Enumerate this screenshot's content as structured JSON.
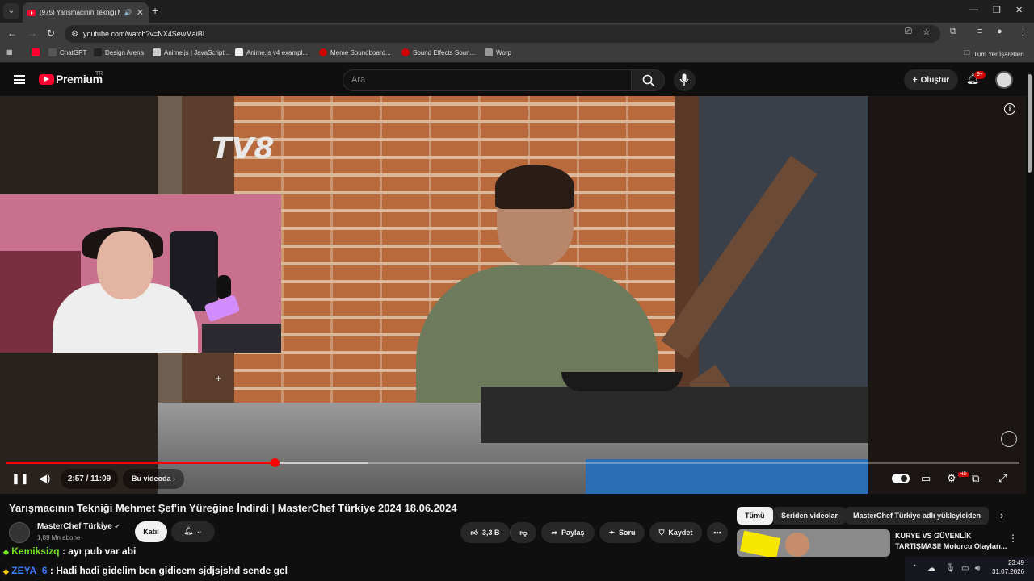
{
  "browser": {
    "tab_title": "(975) Yarışmacının Tekniği M",
    "url": "youtube.com/watch?v=NX4SewMaiBI",
    "bookmarks": [
      "ChatGPT",
      "Design Arena",
      "Anime.js | JavaScript...",
      "Anime.js v4 exampl...",
      "Meme Soundboard...",
      "Sound Effects Soun...",
      "Worp"
    ],
    "bookmarks_all": "Tüm Yer İşaretleri"
  },
  "header": {
    "logo_text": "Premium",
    "region": "TR",
    "search_placeholder": "Ara",
    "create_label": "Oluştur",
    "notif_count": "9+"
  },
  "player": {
    "watermark": "TV8",
    "time": "2:57 / 11:09",
    "chapter_label": "Bu videoda",
    "progress_fraction": 0.265,
    "buffered_fraction": 0.357,
    "hd_badge": "HD"
  },
  "video": {
    "title": "Yarışmacının Tekniği Mehmet Şef'in Yüreğine İndirdi | MasterChef Türkiye 2024 18.06.2024",
    "channel": "MasterChef Türkiye",
    "subscribers": "1,89 Mn abone",
    "join_label": "Katıl",
    "likes": "3,3 B",
    "share_label": "Paylaş",
    "ask_label": "Soru",
    "save_label": "Kaydet"
  },
  "chips": [
    "Tümü",
    "Seriden videolar",
    "MasterChef Türkiye adlı yükleyiciden"
  ],
  "related": {
    "title": "KURYE VS GÜVENLİK TARTIŞMASI! Motorcu Olayları..."
  },
  "chat": [
    {
      "user": "Kemiksizq",
      "message": ": ayı pub var abi"
    },
    {
      "user": "ZEYA_6",
      "message": ": Hadi hadi gidelim ben gidicem sjdjsjshd sende gel"
    }
  ],
  "taskbar": {
    "time": "23:49",
    "date": "31.07.2026"
  }
}
